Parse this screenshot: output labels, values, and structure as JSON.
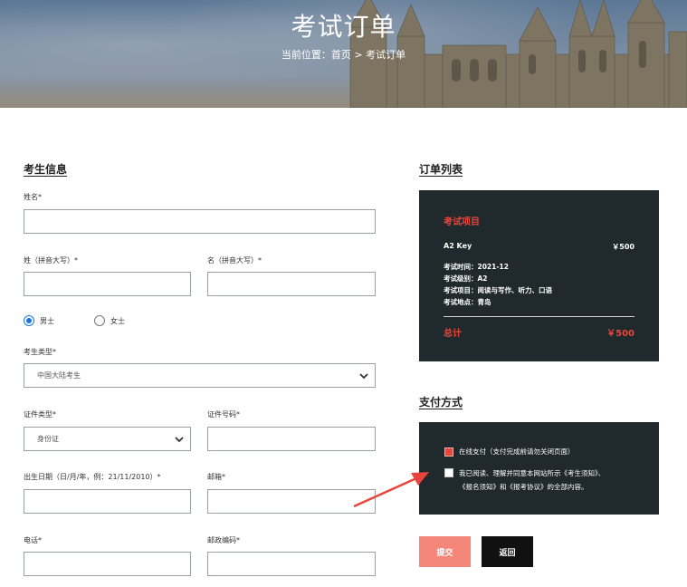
{
  "hero": {
    "title": "考试订单",
    "breadcrumb": "当前位置：首页 > 考试订单"
  },
  "candidate": {
    "section_title": "考生信息",
    "name_label": "姓名*",
    "surname_label": "姓（拼音大写）*",
    "given_label": "名（拼音大写）*",
    "gender": {
      "male": "男士",
      "female": "女士",
      "selected": "male"
    },
    "type_label": "考生类型*",
    "type_value": "中国大陆考生",
    "id_type_label": "证件类型*",
    "id_type_value": "身份证",
    "id_number_label": "证件号码*",
    "dob_label": "出生日期（日/月/年，例：21/11/2010）*",
    "email_label": "邮箱*",
    "phone_label": "电话*",
    "postcode_label": "邮政编码*"
  },
  "order": {
    "section_title": "订单列表",
    "head": "考试项目",
    "item_name": "A2 Key",
    "item_price": "￥500",
    "details": [
      "考试时间：2021-12",
      "考试级别：A2",
      "考试项目：阅读与写作、听力、口语",
      "考试地点：青岛"
    ],
    "total_label": "总计",
    "total_value": "￥500"
  },
  "payment": {
    "section_title": "支付方式",
    "online_label": "在线支付（支付完成前请勿关闭页面）",
    "online_checked": true,
    "agree_line1": "我已阅读、理解并同意本网站所示《考生须知》、",
    "agree_line2": "《报名须知》和《报考协议》的全部内容。",
    "agree_checked": false
  },
  "buttons": {
    "submit": "提交",
    "back": "返回"
  },
  "colors": {
    "accent": "#e8453c",
    "panel": "#20292c",
    "submit": "#f4877a",
    "back": "#111111"
  }
}
